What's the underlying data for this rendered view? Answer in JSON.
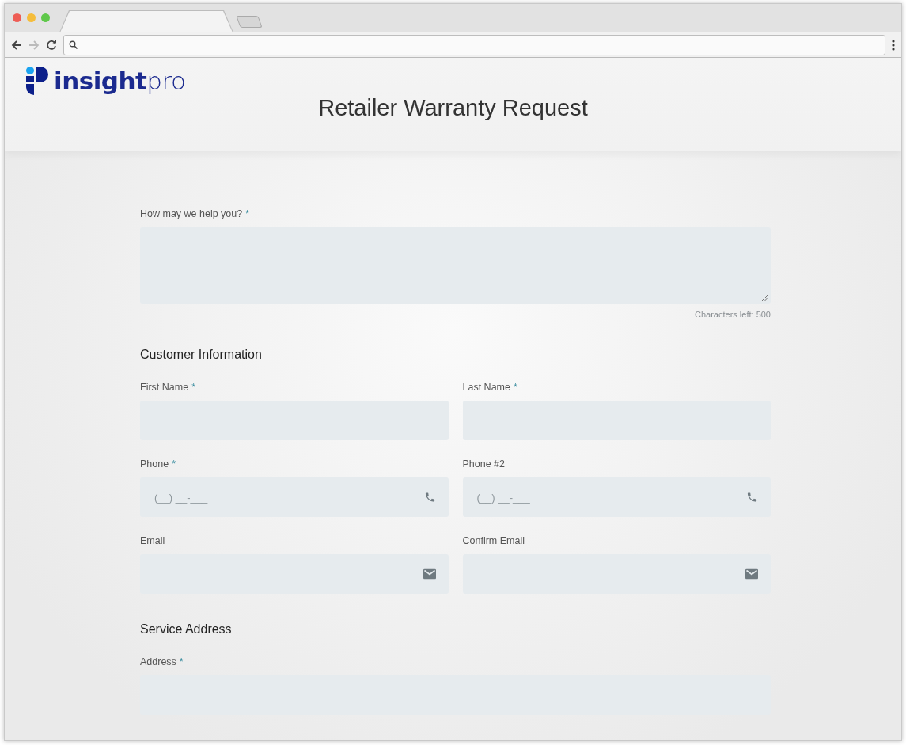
{
  "header": {
    "logo": "**insight**pro",
    "title": "Retailer Warranty Request"
  },
  "sections": [
    {
      "rows": [
        [
          {
            "kind": "textarea",
            "label": "How may we help you?",
            "required_mark": "*",
            "counter": "Characters left: 500"
          }
        ]
      ]
    },
    {
      "heading": "Customer Information",
      "rows": [
        [
          {
            "kind": "text",
            "label": "First Name",
            "required_mark": "*"
          },
          {
            "kind": "text",
            "label": "Last Name",
            "required_mark": "*"
          }
        ],
        [
          {
            "kind": "phone",
            "label": "Phone",
            "required_mark": "*",
            "placeholder": "(__) __-___"
          },
          {
            "kind": "phone",
            "label": "Phone #2",
            "placeholder": "(__) __-___"
          }
        ],
        [
          {
            "kind": "email",
            "label": "Email"
          },
          {
            "kind": "email",
            "label": "Confirm Email"
          }
        ]
      ]
    },
    {
      "heading": "Service Address",
      "rows": [
        [
          {
            "kind": "text",
            "label": "Address",
            "required_mark": "*"
          }
        ]
      ]
    }
  ]
}
